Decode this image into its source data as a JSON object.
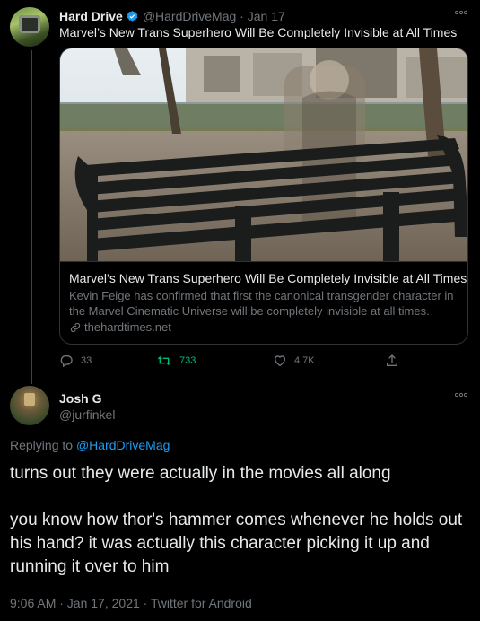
{
  "tweet1": {
    "display_name": "Hard Drive",
    "handle": "@HardDriveMag",
    "date": "Jan 17",
    "text": "Marvel’s New Trans Superhero Will Be Completely Invisible at All Times",
    "card": {
      "title": "Marvel’s New Trans Superhero Will Be Completely Invisible at All Times",
      "description": "Kevin Feige has confirmed that first the canonical transgender character in the Marvel Cinematic Universe will be completely invisible at all times.",
      "domain": "thehardtimes.net"
    },
    "actions": {
      "replies": "33",
      "retweets": "733",
      "likes": "4.7K"
    }
  },
  "tweet2": {
    "display_name": "Josh G",
    "handle": "@jurfinkel",
    "replying_prefix": "Replying to ",
    "replying_to": "@HardDriveMag",
    "text_para1": "turns out they were actually in the movies all along",
    "text_para2": "you know how thor's hammer comes whenever he holds out his hand? it was actually this character picking it up and running it over to him",
    "meta": "9:06 AM · Jan 17, 2021 · Twitter for Android"
  },
  "colors": {
    "background": "#000000",
    "text": "#e7e9ea",
    "muted": "#71767b",
    "link": "#1d9bf0",
    "retweet": "#00ba7c",
    "verified": "#1d9bf0"
  }
}
